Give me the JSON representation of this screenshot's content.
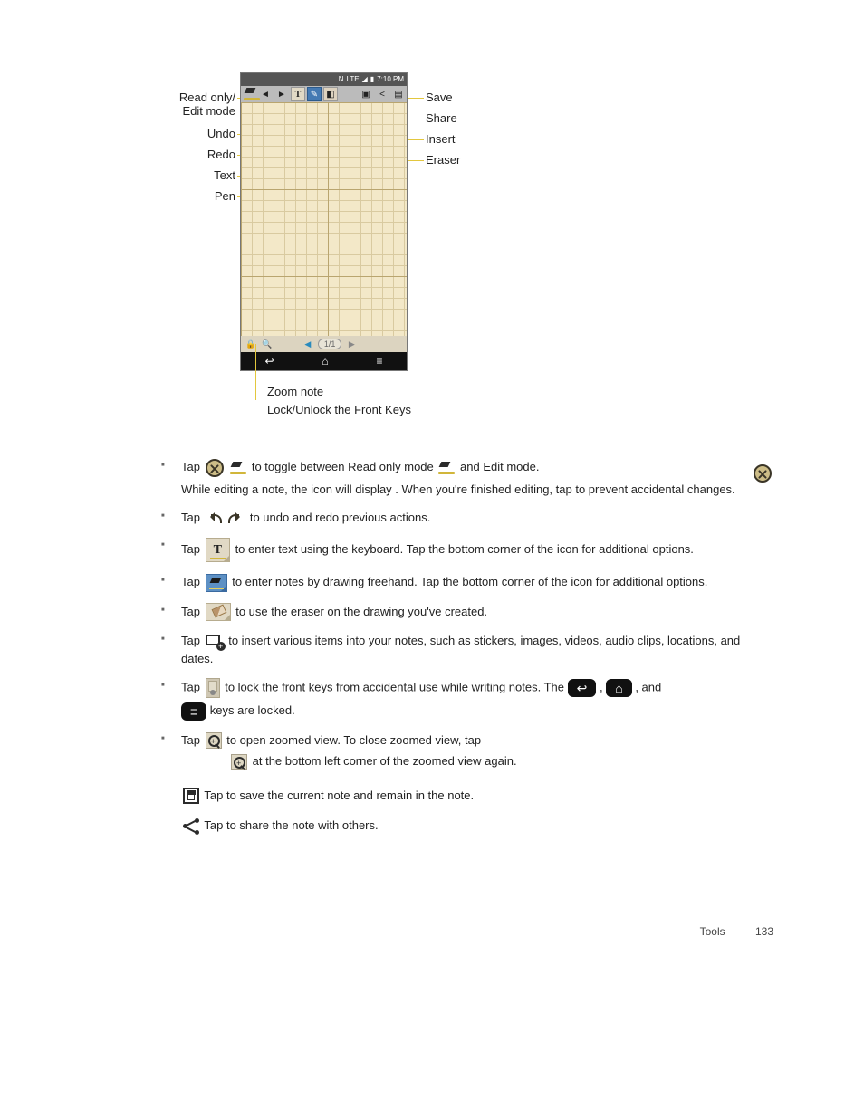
{
  "figure": {
    "statusbar_time": "7:10 PM",
    "page_indicator": "1/1",
    "labels_left": {
      "readonly": "Read only/\nEdit mode",
      "undo": "Undo",
      "redo": "Redo",
      "text": "Text",
      "pen": "Pen"
    },
    "labels_right": {
      "save": "Save",
      "share": "Share",
      "insert": "Insert",
      "eraser": "Eraser"
    },
    "captions": {
      "zoom": "Zoom note",
      "lock": "Lock/Unlock the Front Keys"
    }
  },
  "items": [
    {
      "pre": "Tap",
      "mid1": "to toggle between Read only mode",
      "mid2": "and Edit mode.",
      "line2": "While editing a note, the icon will display . When you're finished editing, tap to prevent accidental changes."
    },
    {
      "pre": "Tap",
      "tail": "to undo and redo previous actions."
    },
    {
      "pre": "Tap",
      "mid": "to enter text using the keyboard. Tap the bottom corner of the icon for additional options."
    },
    {
      "pre": "Tap",
      "mid": "to enter notes by drawing freehand. Tap the bottom corner of the icon for additional options."
    },
    {
      "pre": "Tap",
      "mid": "to use the eraser on the drawing you've created."
    },
    {
      "pre": "Tap",
      "mid": "to insert various items into your notes, such as stickers, images, videos, audio clips, locations, and dates."
    },
    {
      "pre": "Tap",
      "mid1": "to lock the front keys from accidental use while writing notes. The",
      "mid2": ",",
      "mid3": ", and",
      "mid4": "keys are locked."
    },
    {
      "pre": "Tap",
      "mid1": "to open zoomed view. To close zoomed view, tap",
      "mid2": "at the bottom left corner of the zoomed view again."
    }
  ],
  "extra": {
    "save": "Tap to save the current note and remain in the note.",
    "share": "Tap to share the note with others."
  },
  "footer": {
    "section": "Tools",
    "page": "133"
  }
}
